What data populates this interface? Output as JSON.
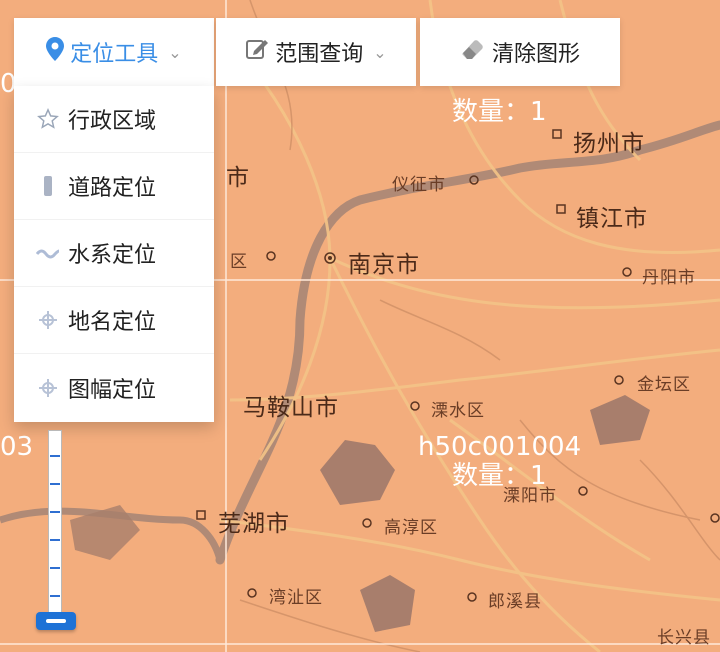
{
  "toolbar": {
    "locate_tool": "定位工具",
    "range_query": "范围查询",
    "clear_graphics": "清除图形"
  },
  "dropdown": {
    "items": [
      "行政区域",
      "道路定位",
      "水系定位",
      "地名定位",
      "图幅定位"
    ]
  },
  "map": {
    "places": {
      "yangzhou": "扬州市",
      "yizheng": "仪征市",
      "zhenjiang": "镇江市",
      "nanjing": "南京市",
      "danyang": "丹阳市",
      "jintan": "金坛区",
      "maanshan": "马鞍山市",
      "lishui": "溧水区",
      "liyang": "溧阳市",
      "wuhu": "芜湖市",
      "gaochun": "高淳区",
      "wanzhi": "湾沚区",
      "langxi": "郎溪县",
      "changxing": "长兴县",
      "partial_city": "市",
      "partial_district": "区"
    },
    "grid_labels": {
      "top_count": "数量：1",
      "sheet_code": "h50c001004",
      "bottom_count": "数量：1",
      "left_edge": "03",
      "top_left_edge": "0"
    }
  },
  "colors": {
    "map_base": "#f3ad7d",
    "water": "#a87e6c",
    "grid": "#ffe9da",
    "accent": "#3a8ee6",
    "zoom": "#1e72d6"
  },
  "icons": {
    "locate": "map-marker-icon",
    "range": "edit-icon",
    "clear": "eraser-icon",
    "admin": "star-icon",
    "road": "road-icon",
    "water": "wave-icon",
    "placename": "crosshair-icon",
    "sheet": "crosshair-icon"
  }
}
